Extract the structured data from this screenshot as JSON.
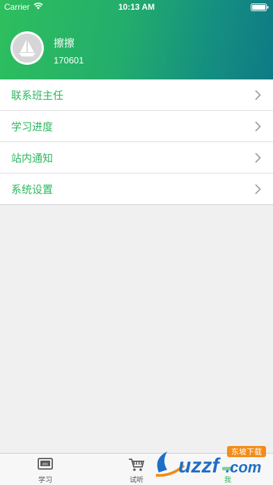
{
  "status_bar": {
    "carrier": "Carrier",
    "time": "10:13 AM"
  },
  "profile": {
    "name": "擦擦",
    "id": "170601"
  },
  "menu": {
    "items": [
      {
        "label": "联系班主任"
      },
      {
        "label": "学习进度"
      },
      {
        "label": "站内通知"
      },
      {
        "label": "系统设置"
      }
    ]
  },
  "tabbar": {
    "tabs": [
      {
        "label": "学习",
        "icon": "book-icon"
      },
      {
        "label": "试听",
        "icon": "cart-icon"
      },
      {
        "label": "我",
        "icon": "profile-icon"
      }
    ],
    "active_index": 2
  },
  "watermark": {
    "text": "uzzf.com",
    "subtext": "东坡下载"
  },
  "colors": {
    "accent": "#2bb85c",
    "header_start": "#2ebf5e",
    "header_end": "#0f7a86"
  }
}
